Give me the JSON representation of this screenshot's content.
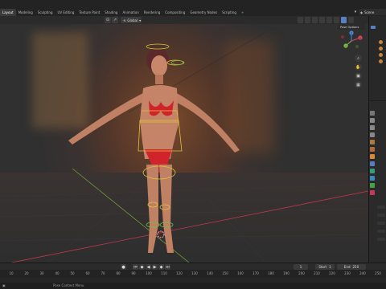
{
  "workspace_tabs": [
    {
      "label": "Layout",
      "active": true
    },
    {
      "label": "Modeling",
      "active": false
    },
    {
      "label": "Sculpting",
      "active": false
    },
    {
      "label": "UV Editing",
      "active": false
    },
    {
      "label": "Texture Paint",
      "active": false
    },
    {
      "label": "Shading",
      "active": false
    },
    {
      "label": "Animation",
      "active": false
    },
    {
      "label": "Rendering",
      "active": false
    },
    {
      "label": "Compositing",
      "active": false
    },
    {
      "label": "Geometry Nodes",
      "active": false
    },
    {
      "label": "Scripting",
      "active": false
    }
  ],
  "add_tab": "+",
  "scene_label": "Scene",
  "viewport_header": {
    "transform_orientation": "Global",
    "pose_options": "Pose Options"
  },
  "navigation_gizmo": {
    "axes": [
      "X",
      "Y",
      "Z"
    ]
  },
  "timeline": {
    "current_frame": "1",
    "start_label": "Start",
    "start_value": "1",
    "end_label": "End",
    "end_value": "250",
    "ruler_ticks": [
      "10",
      "20",
      "30",
      "40",
      "50",
      "60",
      "70",
      "80",
      "90",
      "100",
      "110",
      "120",
      "130",
      "140",
      "150",
      "160",
      "170",
      "180",
      "190",
      "200",
      "210",
      "220",
      "230",
      "240",
      "250"
    ]
  },
  "status": {
    "left": "",
    "message": "Pose Context Menu"
  },
  "colors": {
    "active_shading": "#5680c2",
    "axis_x": "#e0445b",
    "axis_y": "#7fbf3f",
    "axis_z": "#4a8ae0",
    "armature": "#e0c23a"
  }
}
